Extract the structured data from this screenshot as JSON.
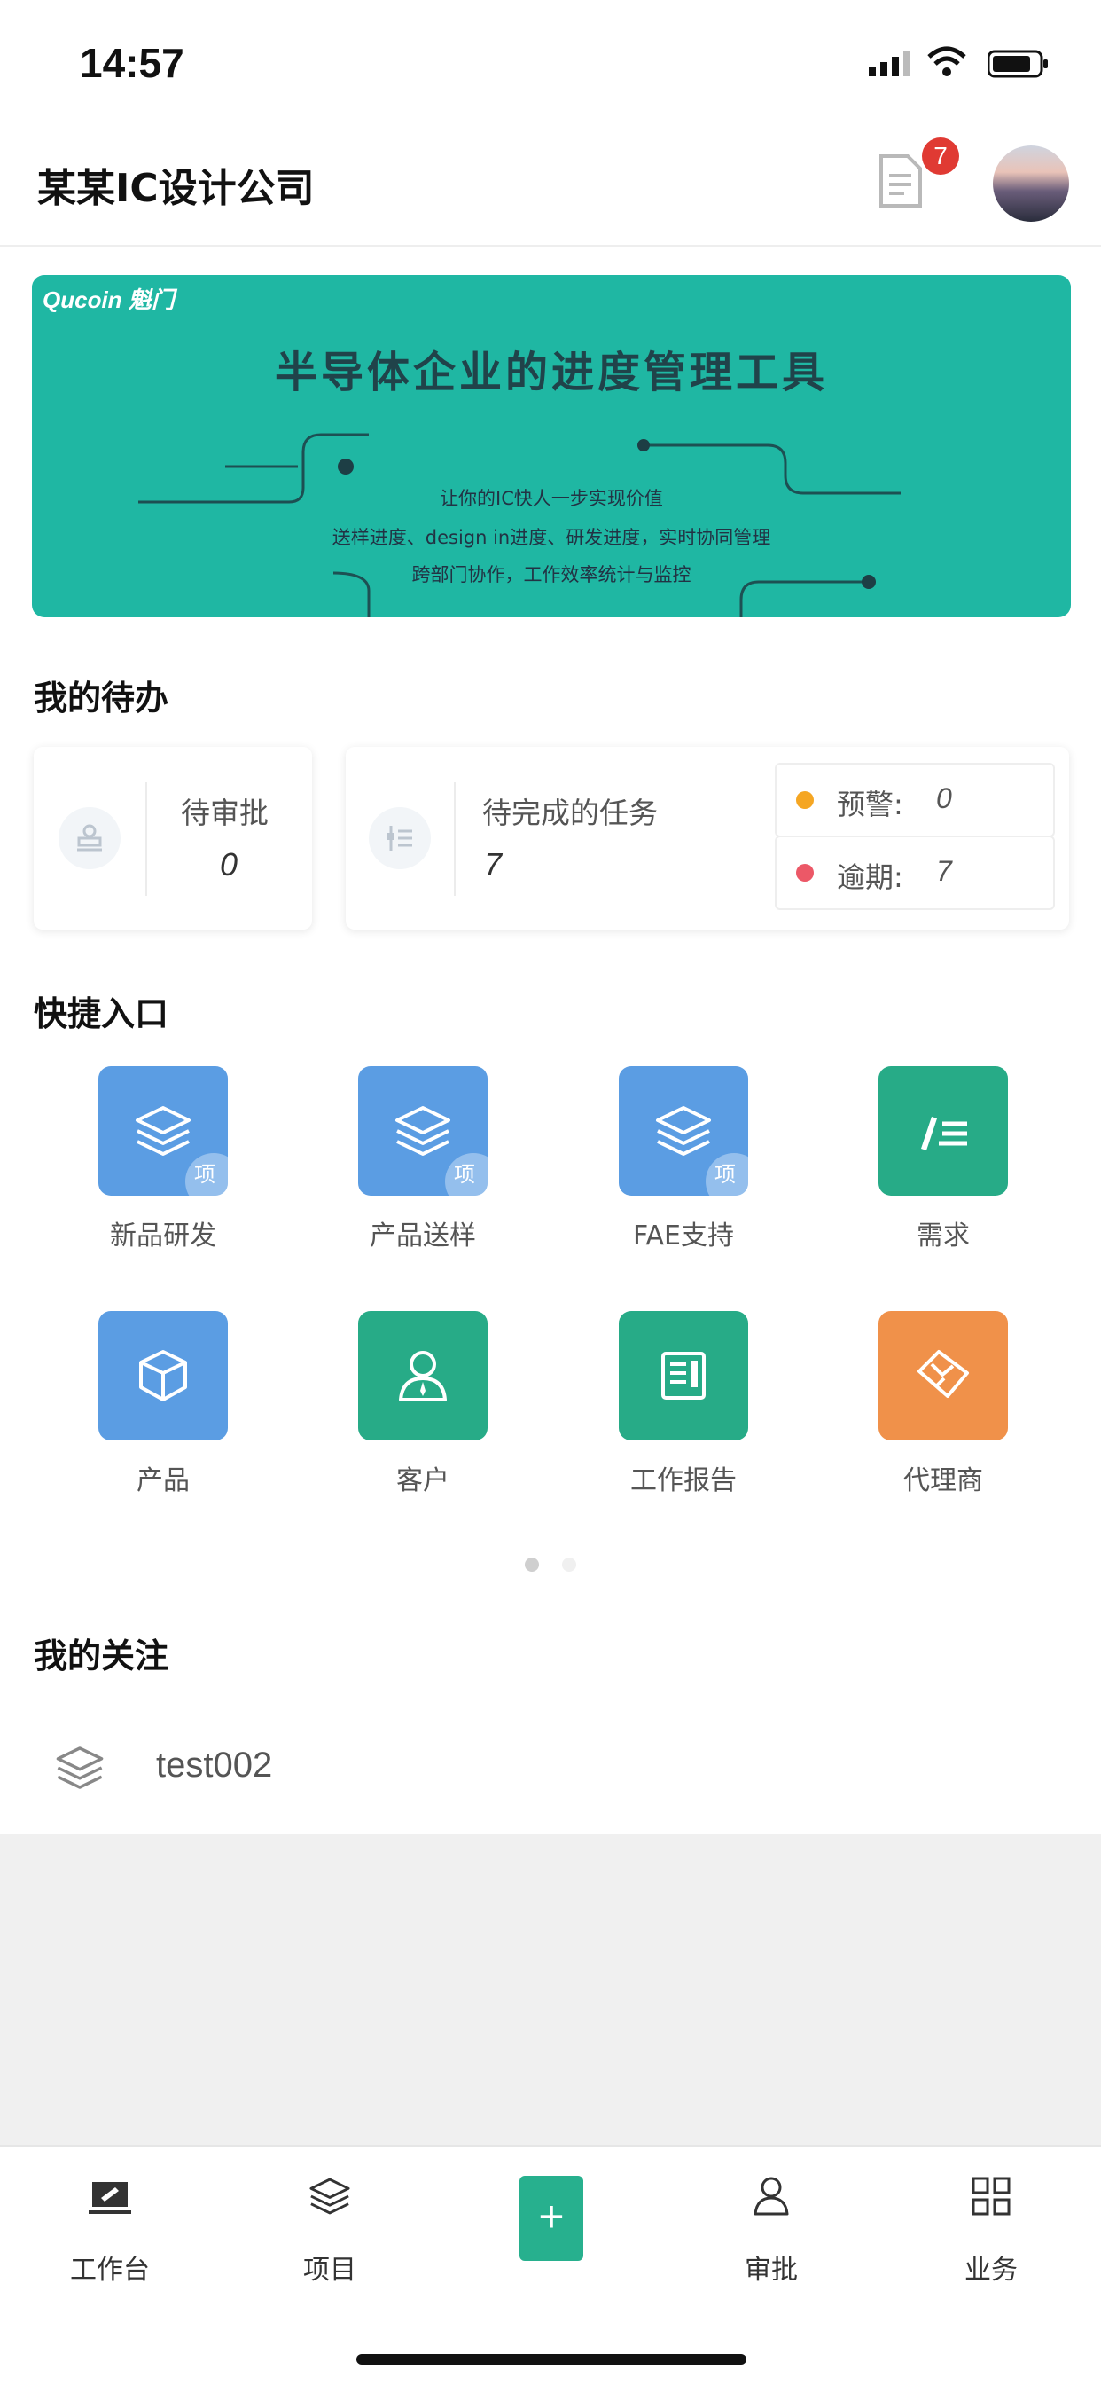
{
  "status_bar": {
    "time": "14:57"
  },
  "header": {
    "title": "某某IC设计公司",
    "notification_count": "7"
  },
  "banner": {
    "logo": "Qucoin 魁门",
    "title": "半导体企业的进度管理工具",
    "lines": [
      "让你的IC快人一步实现价值",
      "送样进度、design in进度、研发进度，实时协同管理",
      "跨部门协作，工作效率统计与监控"
    ]
  },
  "todo": {
    "section_title": "我的待办",
    "approval": {
      "label": "待审批",
      "value": "0"
    },
    "tasks": {
      "label": "待完成的任务",
      "value": "7"
    },
    "warning": {
      "label": "预警:",
      "value": "0",
      "color": "#f5a623"
    },
    "overdue": {
      "label": "逾期:",
      "value": "7",
      "color": "#ec5867"
    }
  },
  "quick": {
    "section_title": "快捷入口",
    "items": [
      {
        "label": "新品研发",
        "icon": "layers-icon",
        "tag": "项",
        "color": "#5b9de3"
      },
      {
        "label": "产品送样",
        "icon": "layers-icon",
        "tag": "项",
        "color": "#5b9de3"
      },
      {
        "label": "FAE支持",
        "icon": "layers-icon",
        "tag": "项",
        "color": "#5b9de3"
      },
      {
        "label": "需求",
        "icon": "edit-list-icon",
        "tag": "",
        "color": "#27ab87"
      },
      {
        "label": "产品",
        "icon": "box-icon",
        "tag": "",
        "color": "#5b9de3"
      },
      {
        "label": "客户",
        "icon": "person-icon",
        "tag": "",
        "color": "#27ab87"
      },
      {
        "label": "工作报告",
        "icon": "report-icon",
        "tag": "",
        "color": "#27ab87"
      },
      {
        "label": "代理商",
        "icon": "handshake-icon",
        "tag": "",
        "color": "#f0914a"
      }
    ],
    "page_index": 1,
    "page_count": 2
  },
  "follow": {
    "section_title": "我的关注",
    "items": [
      {
        "label": "test002",
        "icon": "layers-icon"
      }
    ]
  },
  "tabbar": {
    "items": [
      {
        "label": "工作台",
        "icon": "desk-icon"
      },
      {
        "label": "项目",
        "icon": "layers-icon"
      },
      {
        "label": "",
        "icon": "plus-icon"
      },
      {
        "label": "审批",
        "icon": "person-icon"
      },
      {
        "label": "业务",
        "icon": "grid-icon"
      }
    ],
    "plus_label": "+"
  }
}
